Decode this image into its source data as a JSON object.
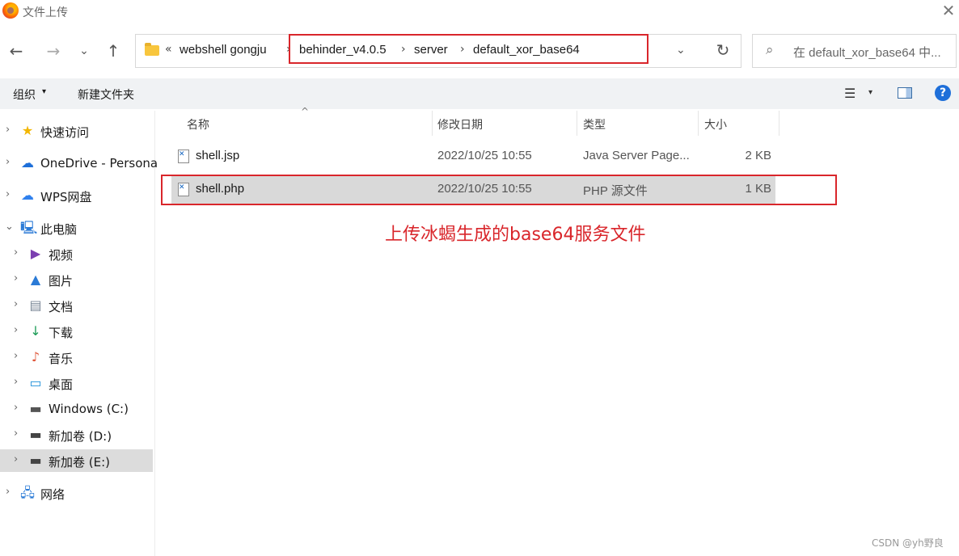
{
  "window": {
    "title": "文件上传",
    "close_icon": "close-icon"
  },
  "nav": {
    "back_icon": "←",
    "forward_icon": "→",
    "recent_icon": "⌄",
    "up_icon": "↑",
    "address": {
      "overflow": "«",
      "crumbs": [
        "webshell gongju",
        "behinder_v4.0.5",
        "server",
        "default_xor_base64"
      ],
      "separator": "›",
      "dropdown": "⌄",
      "refresh": "↻"
    },
    "search": {
      "placeholder": "在 default_xor_base64 中...",
      "icon": "⌕"
    }
  },
  "toolbar": {
    "organize": "组织",
    "organize_caret": "▾",
    "new_folder": "新建文件夹",
    "view_icon": "☰",
    "view_caret": "▾",
    "help": "?"
  },
  "sidebar": {
    "items": [
      {
        "label": "快速访问",
        "icon": "★",
        "icon_color": "#f2b600",
        "chev": "›"
      },
      {
        "label": "OneDrive - Persona",
        "icon": "☁",
        "icon_color": "#1e6fd9",
        "chev": "›"
      },
      {
        "label": "WPS网盘",
        "icon": "☁",
        "icon_color": "#2f80ed",
        "chev": "›"
      },
      {
        "label": "此电脑",
        "icon": "🖳",
        "icon_color": "#2a7ad6",
        "chev": "⌄"
      },
      {
        "label": "视频",
        "icon": "▶",
        "icon_color": "#7b3fb0",
        "chev": "›"
      },
      {
        "label": "图片",
        "icon": "▲",
        "icon_color": "#2a7ad6",
        "chev": "›"
      },
      {
        "label": "文档",
        "icon": "▤",
        "icon_color": "#7a8796",
        "chev": "›"
      },
      {
        "label": "下载",
        "icon": "↓",
        "icon_color": "#1b9b55",
        "chev": "›"
      },
      {
        "label": "音乐",
        "icon": "♪",
        "icon_color": "#e0573b",
        "chev": "›"
      },
      {
        "label": "桌面",
        "icon": "▭",
        "icon_color": "#1e8fd9",
        "chev": "›"
      },
      {
        "label": "Windows (C:)",
        "icon": "▬",
        "icon_color": "#555555",
        "chev": "›"
      },
      {
        "label": "新加卷 (D:)",
        "icon": "▬",
        "icon_color": "#444444",
        "chev": "›"
      },
      {
        "label": "新加卷 (E:)",
        "icon": "▬",
        "icon_color": "#444444",
        "chev": "›"
      },
      {
        "label": "网络",
        "icon": "🖧",
        "icon_color": "#2a7ad6",
        "chev": "›"
      }
    ]
  },
  "list": {
    "columns": [
      "名称",
      "修改日期",
      "类型",
      "大小"
    ],
    "sort_indicator": "^",
    "rows": [
      {
        "name": "shell.jsp",
        "date": "2022/10/25 10:55",
        "type": "Java Server Page...",
        "size": "2 KB"
      },
      {
        "name": "shell.php",
        "date": "2022/10/25 10:55",
        "type": "PHP 源文件",
        "size": "1 KB"
      }
    ]
  },
  "annotation": "上传冰蝎生成的base64服务文件",
  "watermark": "CSDN @yh野良",
  "colors": {
    "highlight": "#d9262b",
    "accent": "#1e6fd9"
  }
}
